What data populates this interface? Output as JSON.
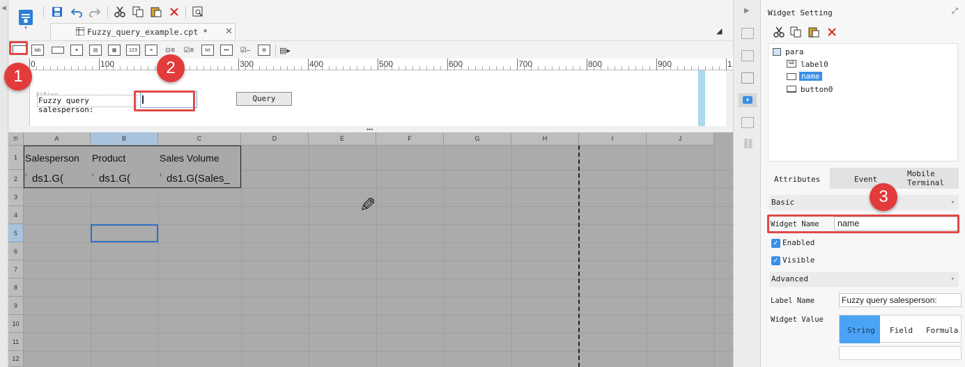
{
  "tab": {
    "filename": "Fuzzy_query_example.cpt *"
  },
  "ruler": {
    "labels": [
      "0",
      "100",
      "200",
      "300",
      "400",
      "500",
      "600",
      "700",
      "800",
      "900",
      "1"
    ],
    "marker": "157PX"
  },
  "param_panel": {
    "fixed_tag": "3|Fixe",
    "label_text": "Fuzzy query salesperson:",
    "query_button": "Query"
  },
  "grid": {
    "columns": [
      "A",
      "B",
      "C",
      "D",
      "E",
      "F",
      "G",
      "H",
      "I",
      "J"
    ],
    "rows": [
      "1",
      "2",
      "3",
      "4",
      "5",
      "6",
      "7",
      "8",
      "9",
      "10",
      "11",
      "12"
    ],
    "corner": "!!!",
    "header_cells": [
      "Salesperson",
      "Product",
      "Sales Volume"
    ],
    "formula_cells": [
      "ds1.G(",
      "ds1.G(",
      "ds1.G(Sales_"
    ]
  },
  "widget_setting": {
    "title": "Widget Setting",
    "tree": [
      {
        "label": "para",
        "icon": "form-icon"
      },
      {
        "label": "label0",
        "icon": "label-widget-icon"
      },
      {
        "label": "name",
        "icon": "text-widget-icon",
        "selected": true
      },
      {
        "label": "button0",
        "icon": "button-widget-icon"
      }
    ],
    "tabs": [
      "Attributes",
      "Event",
      "Mobile Terminal"
    ],
    "basic_section": "Basic",
    "widget_name_label": "Widget Name",
    "widget_name_value": "name",
    "enabled_label": "Enabled",
    "visible_label": "Visible",
    "advanced_section": "Advanced",
    "label_name_label": "Label Name",
    "label_name_value": "Fuzzy query salesperson:",
    "widget_value_label": "Widget Value",
    "value_types": [
      "String",
      "Field",
      "Formula"
    ],
    "active_value_type": "String"
  },
  "annotations": {
    "markers": [
      "1",
      "2",
      "3"
    ]
  },
  "colors": {
    "accent": "#3a8fe6",
    "highlight": "#e04848",
    "grid_bg": "#ababab",
    "selected_tab": "#4aa3f5"
  }
}
